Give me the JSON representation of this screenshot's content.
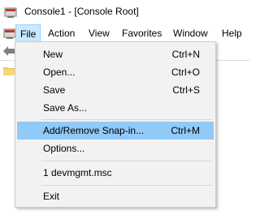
{
  "window": {
    "title": "Console1 - [Console Root]"
  },
  "menubar": {
    "items": [
      {
        "label": "File"
      },
      {
        "label": "Action"
      },
      {
        "label": "View"
      },
      {
        "label": "Favorites"
      },
      {
        "label": "Window"
      },
      {
        "label": "Help"
      }
    ]
  },
  "file_menu": {
    "items": [
      {
        "label": "New",
        "shortcut": "Ctrl+N"
      },
      {
        "label": "Open...",
        "shortcut": "Ctrl+O"
      },
      {
        "label": "Save",
        "shortcut": "Ctrl+S"
      },
      {
        "label": "Save As...",
        "shortcut": ""
      },
      {
        "label": "Add/Remove Snap-in...",
        "shortcut": "Ctrl+M",
        "highlighted": true
      },
      {
        "label": "Options...",
        "shortcut": ""
      },
      {
        "label": "1 devmgmt.msc",
        "shortcut": ""
      },
      {
        "label": "Exit",
        "shortcut": ""
      }
    ]
  },
  "colors": {
    "highlight": "#91c9f7",
    "menu_background": "#f2f2f2",
    "active_menubar_item": "#cce8ff"
  },
  "icons": [
    "mmc-app-icon",
    "back-arrow-icon",
    "folder-icon"
  ]
}
